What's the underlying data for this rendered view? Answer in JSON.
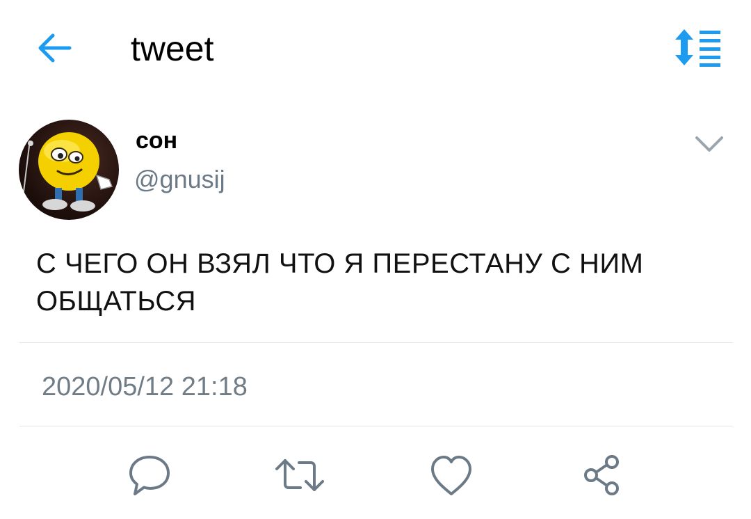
{
  "header": {
    "title": "tweet",
    "back_icon": "arrow-left-icon",
    "sort_icon": "sort-list-icon",
    "accent_color": "#1d9bf0"
  },
  "tweet": {
    "display_name": "сон",
    "handle": "@gnusij",
    "text": "С ЧЕГО ОН ВЗЯЛ ЧТО Я ПЕРЕСТАНУ С НИМ ОБЩАТЬСЯ",
    "timestamp": "2020/05/12 21:18",
    "avatar_icon": "smiley-avatar"
  },
  "actions": [
    {
      "name": "reply-icon"
    },
    {
      "name": "retweet-icon"
    },
    {
      "name": "like-icon"
    },
    {
      "name": "share-icon"
    }
  ]
}
